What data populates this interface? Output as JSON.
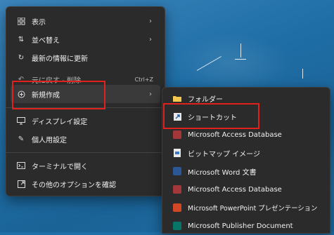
{
  "context_menu": {
    "items": [
      {
        "label": "表示",
        "icon": "grid-icon",
        "chevron": "›"
      },
      {
        "label": "並べ替え",
        "icon": "sort-icon",
        "chevron": "›"
      },
      {
        "label": "最新の情報に更新",
        "icon": "refresh-icon"
      },
      {
        "label": "元に戻す - 削除",
        "icon": "undo-icon",
        "shortcut": "Ctrl+Z"
      },
      {
        "label": "新規作成",
        "icon": "new-icon",
        "chevron": "›"
      },
      {
        "label": "ディスプレイ設定",
        "icon": "display-icon"
      },
      {
        "label": "個人用設定",
        "icon": "brush-icon"
      },
      {
        "label": "ターミナルで開く",
        "icon": "terminal-icon"
      },
      {
        "label": "その他のオプションを確認",
        "icon": "more-options-icon"
      }
    ]
  },
  "submenu": {
    "items": [
      {
        "label": "フォルダー",
        "icon": "folder-icon",
        "color": "#f2c94c"
      },
      {
        "label": "ショートカット",
        "icon": "shortcut-icon",
        "color": "#e8e8e8"
      },
      {
        "label": "Microsoft Access Database",
        "icon": "access-icon",
        "color": "#a4373a"
      },
      {
        "label": "ビットマップ イメージ",
        "icon": "bitmap-icon",
        "color": "#e8e8e8"
      },
      {
        "label": "Microsoft Word 文書",
        "icon": "word-icon",
        "color": "#2b5797"
      },
      {
        "label": "Microsoft Access Database",
        "icon": "access-icon",
        "color": "#a4373a"
      },
      {
        "label": "Microsoft PowerPoint プレゼンテーション",
        "icon": "powerpoint-icon",
        "color": "#d24726"
      },
      {
        "label": "Microsoft Publisher Document",
        "icon": "publisher-icon",
        "color": "#077568"
      }
    ]
  },
  "colors": {
    "highlight": "#e0211d",
    "menu_bg": "#2b2b2b"
  }
}
